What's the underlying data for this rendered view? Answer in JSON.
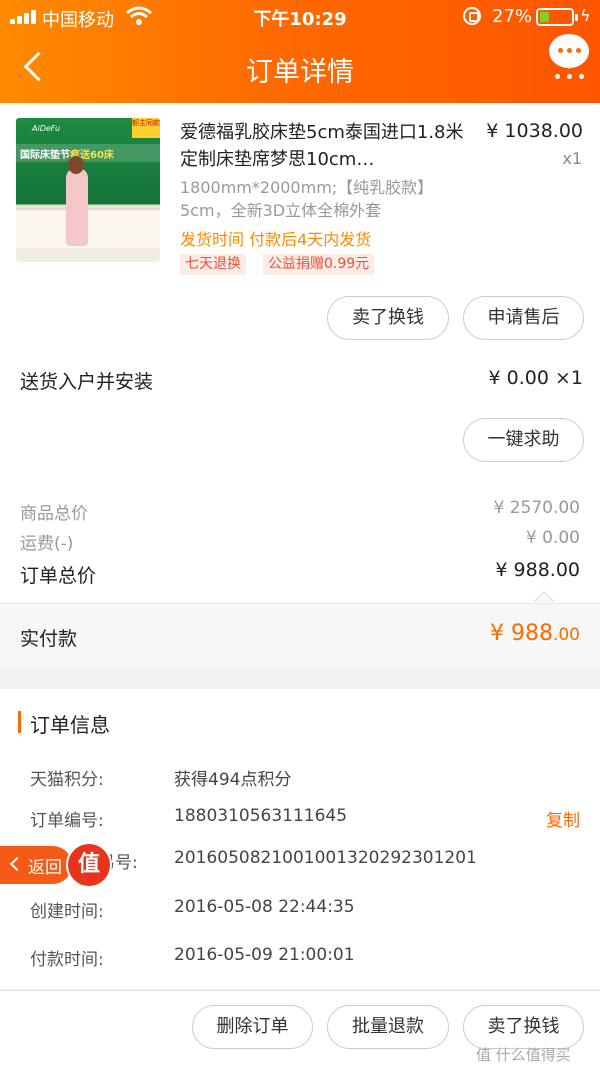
{
  "status_bar": {
    "carrier": "中国移动",
    "time": "下午10:29",
    "battery": "27%"
  },
  "header": {
    "title": "订单详情"
  },
  "product": {
    "image_brand": "AiDeFu",
    "image_badge": "额主同款",
    "image_text_a": "国际床垫节",
    "image_text_b": "疯送60床",
    "name": "爱德福乳胶床垫5cm泰国进口1.8米定制床垫席梦思10cm…",
    "price": "¥ 1038.00",
    "qty": "x1",
    "spec": "1800mm*2000mm;【纯乳胶款】5cm，全新3D立体全棉外套",
    "shipping": "发货时间  付款后4天内发货",
    "tags": [
      "七天退换",
      "公益捐赠0.99元"
    ]
  },
  "product_actions": {
    "sell": "卖了换钱",
    "after_sale": "申请售后"
  },
  "service": {
    "label": "送货入户并安装",
    "value": "¥ 0.00 ×1",
    "help": "一键求助"
  },
  "summary": {
    "goods_label": "商品总价",
    "goods_value": "¥ 2570.00",
    "shipping_label": "运费(-)",
    "shipping_value": "¥ 0.00",
    "total_label": "订单总价",
    "total_value": "¥ 988.00"
  },
  "paid": {
    "label": "实付款",
    "value_int": "¥ 988",
    "value_dec": ".00"
  },
  "order_info": {
    "title": "订单信息",
    "copy": "复制",
    "rows": [
      {
        "label": "天猫积分:",
        "value": "获得494点积分"
      },
      {
        "label": "订单编号:",
        "value": "1880310563111645"
      },
      {
        "label": "支付宝交易号:",
        "value": "2016050821001001320292301201"
      },
      {
        "label": "创建时间:",
        "value": "2016-05-08 22:44:35"
      },
      {
        "label": "付款时间:",
        "value": "2016-05-09 21:00:01"
      }
    ]
  },
  "floating": {
    "back": "返回",
    "zhi": "值"
  },
  "bottom_actions": {
    "delete": "删除订单",
    "batch_refund": "批量退款",
    "sell": "卖了换钱"
  },
  "watermark": "值 什么值得买",
  "colors": {
    "accent": "#ff6a00",
    "tag": "#f0513b",
    "ship": "#ff8a00"
  }
}
